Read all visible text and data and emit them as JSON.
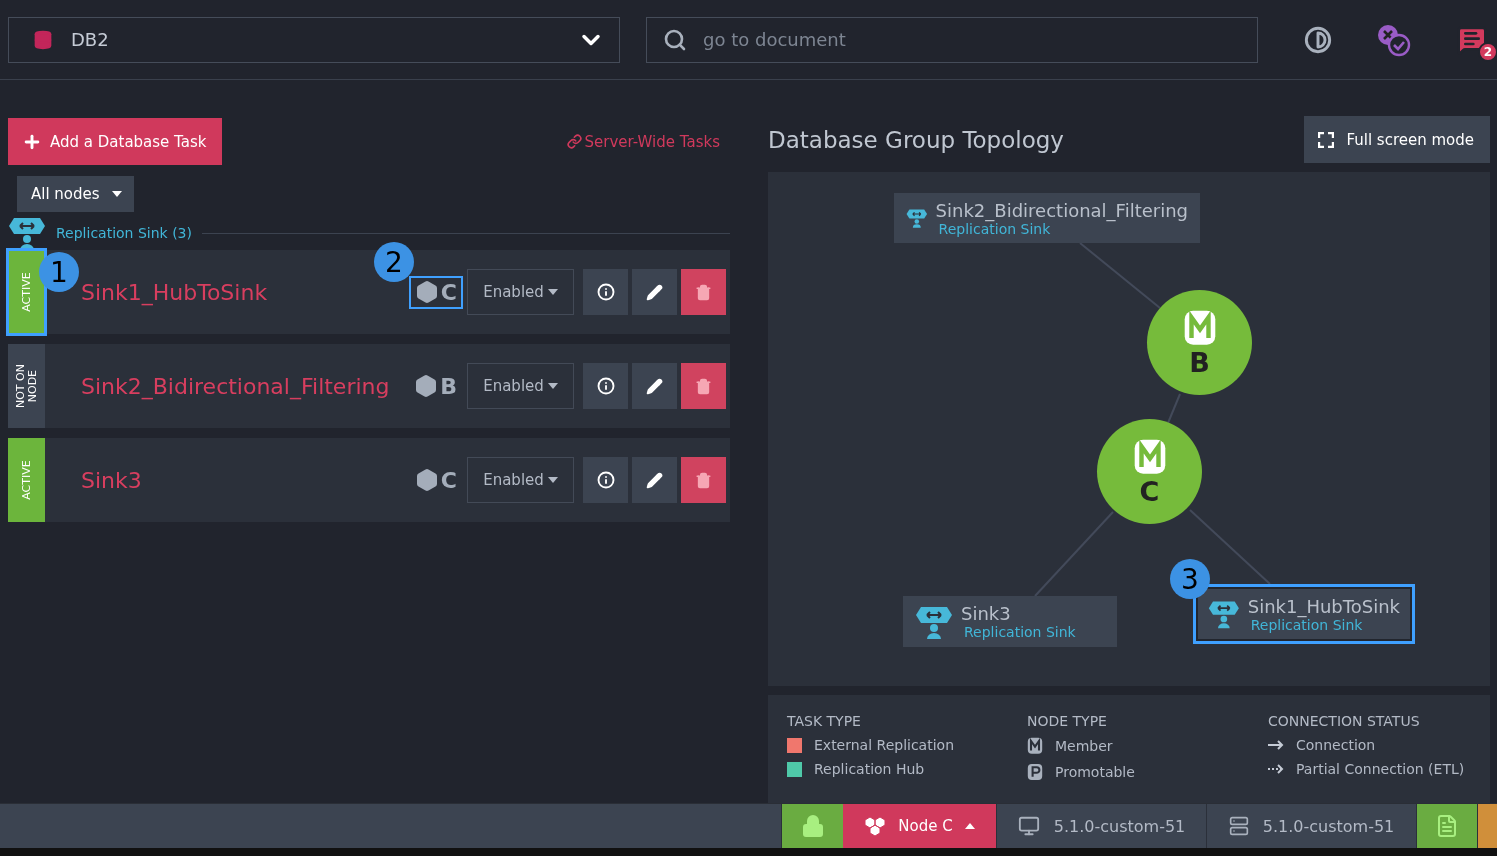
{
  "database_selector": {
    "value": "DB2"
  },
  "search": {
    "placeholder": "go to document"
  },
  "notifications": {
    "count": "2"
  },
  "add_task_button": "Add a Database Task",
  "server_wide_link": "Server-Wide Tasks",
  "node_filter": "All nodes",
  "group": {
    "title": "Replication Sink (3)"
  },
  "tasks": [
    {
      "color": "#6cb53c",
      "state": "ACTIVE",
      "name": "Sink1_HubToSink",
      "node": "C",
      "mode": "Enabled",
      "state_callout": "1",
      "node_callout": "2"
    },
    {
      "color": "#3c4451",
      "state": "NOT ON NODE",
      "name": "Sink2_Bidirectional_Filtering",
      "node": "B",
      "mode": "Enabled"
    },
    {
      "color": "#6cb53c",
      "state": "ACTIVE",
      "name": "Sink3",
      "node": "C",
      "mode": "Enabled"
    }
  ],
  "topology": {
    "title": "Database Group Topology",
    "fullscreen_button": "Full screen mode",
    "tasks": [
      {
        "name": "Sink2_Bidirectional_Filtering",
        "type": "Replication Sink"
      },
      {
        "name": "Sink3",
        "type": "Replication Sink"
      },
      {
        "name": "Sink1_HubToSink",
        "type": "Replication Sink",
        "callout": "3"
      }
    ],
    "nodes": [
      {
        "label": "B",
        "kind": "member"
      },
      {
        "label": "C",
        "kind": "member"
      }
    ]
  },
  "legend": [
    {
      "title": "TASK TYPE",
      "items": [
        {
          "label": "External Replication",
          "kind": "swatch",
          "color": "#f0776d"
        },
        {
          "label": "Replication Hub",
          "kind": "swatch",
          "color": "#4fc9a9"
        }
      ]
    },
    {
      "title": "NODE TYPE",
      "items": [
        {
          "label": "Member",
          "kind": "member"
        },
        {
          "label": "Promotable",
          "kind": "promotable"
        }
      ]
    },
    {
      "title": "CONNECTION STATUS",
      "items": [
        {
          "label": "Connection",
          "kind": "connection"
        },
        {
          "label": "Partial Connection (ETL)",
          "kind": "partial"
        }
      ]
    }
  ],
  "status_bar": {
    "node": "Node C",
    "client_version": "5.1.0-custom-51",
    "server_version": "5.1.0-custom-51"
  }
}
